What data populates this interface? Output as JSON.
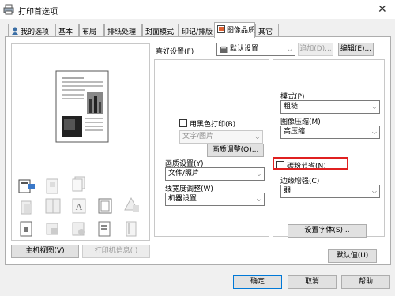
{
  "window": {
    "title": "打印首选项",
    "close_glyph": "✕"
  },
  "tabs": [
    {
      "label": "我的选项",
      "icon": "user-icon"
    },
    {
      "label": "基本"
    },
    {
      "label": "布局"
    },
    {
      "label": "排纸处理"
    },
    {
      "label": "封面模式"
    },
    {
      "label": "印记/排版"
    },
    {
      "label": "图像品质",
      "icon": "image-quality-icon",
      "active": true
    },
    {
      "label": "其它"
    }
  ],
  "favorites": {
    "label": "喜好设置(F)",
    "value": "默认设置",
    "add_button": "追加(D)...",
    "edit_button": "编辑(E)..."
  },
  "left_buttons": {
    "main_view": "主机视图(V)",
    "printer_info": "打印机信息(I)"
  },
  "middle": {
    "bw_print_label": "用黑色打印(B)",
    "bw_print_value": "文字/图片",
    "quality_adjust_button": "画质调整(Q)...",
    "image_settings_label": "画质设置(Y)",
    "image_settings_value": "文件/照片",
    "line_width_label": "线宽度调整(W)",
    "line_width_value": "机器设置"
  },
  "right": {
    "mode_label": "模式(P)",
    "mode_value": "粗糙",
    "compression_label": "图像压缩(M)",
    "compression_value": "高压缩",
    "toner_save_label": "碳粉节省(N)",
    "edge_enhance_label": "边缘增强(C)",
    "edge_enhance_value": "弱",
    "font_settings_button": "设置字体(S)..."
  },
  "default_button": "默认值(U)",
  "footer": {
    "ok": "确定",
    "cancel": "取消",
    "help": "帮助"
  },
  "colors": {
    "highlight": "#e02020",
    "accent": "#0078d7"
  }
}
